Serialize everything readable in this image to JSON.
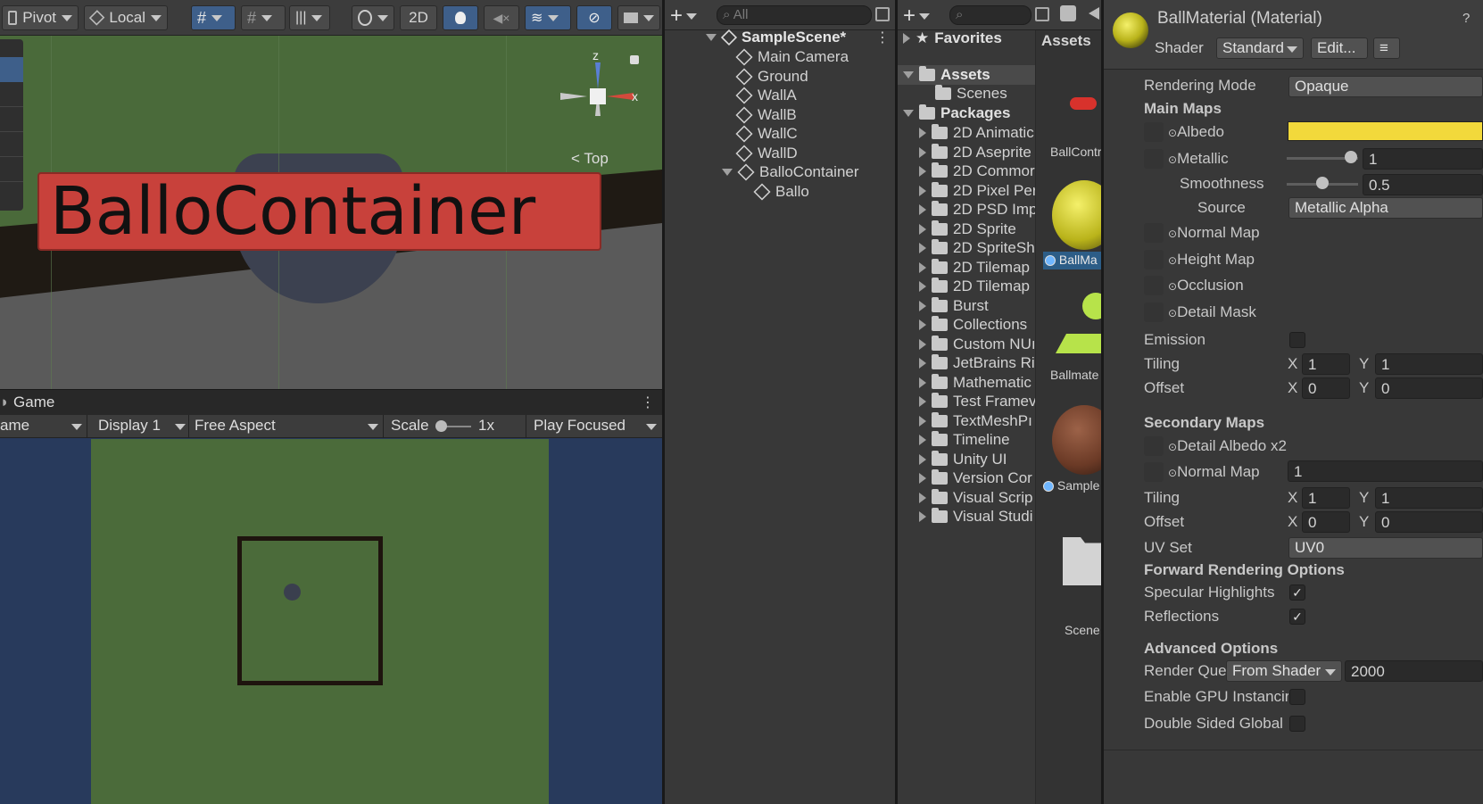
{
  "scene_toolbar": {
    "pivot_label": "Pivot",
    "local_label": "Local",
    "mode_2d_label": "2D"
  },
  "scene_view": {
    "gizmo_z": "z",
    "gizmo_x": "x",
    "gizmo_view_label": "Top",
    "selection_label": "BalloContainer"
  },
  "game_view": {
    "tab_label": "Game",
    "game_dropdown": "ame",
    "display_label": "Display 1",
    "aspect_label": "Free Aspect",
    "scale_label": "Scale",
    "scale_value": "1x",
    "play_focused_label": "Play Focused"
  },
  "hierarchy": {
    "search_placeholder": "All",
    "scene_name": "SampleScene*",
    "items": [
      {
        "label": "Main Camera"
      },
      {
        "label": "Ground"
      },
      {
        "label": "WallA"
      },
      {
        "label": "WallB"
      },
      {
        "label": "WallC"
      },
      {
        "label": "WallD"
      },
      {
        "label": "BalloContainer"
      },
      {
        "label": "Ballo"
      }
    ]
  },
  "project": {
    "favorites_label": "Favorites",
    "assets_label": "Assets",
    "scenes_label": "Scenes",
    "packages_label": "Packages",
    "packages": [
      "2D Animatic",
      "2D Aseprite",
      "2D Commor",
      "2D Pixel Per",
      "2D PSD Imp",
      "2D Sprite",
      "2D SpriteSh",
      "2D Tilemap",
      "2D Tilemap",
      "Burst",
      "Collections",
      "Custom NUı",
      "JetBrains Ri",
      "Mathematic",
      "Test Framev",
      "TextMeshPı",
      "Timeline",
      "Unity UI",
      "Version Cor",
      "Visual Scrip",
      "Visual Studi"
    ],
    "grid_header": "Assets",
    "grid_items": [
      {
        "label": "BallContr"
      },
      {
        "label": "BallMa"
      },
      {
        "label": "Ballmate"
      },
      {
        "label": "Sample"
      },
      {
        "label": "Scene"
      }
    ]
  },
  "inspector": {
    "title": "BallMaterial (Material)",
    "shader_label": "Shader",
    "shader_value": "Standard",
    "edit_label": "Edit...",
    "rendering_mode_label": "Rendering Mode",
    "rendering_mode_value": "Opaque",
    "main_maps_label": "Main Maps",
    "albedo_label": "Albedo",
    "albedo_color": "#f2d93b",
    "metallic_label": "Metallic",
    "metallic_value": "1",
    "smoothness_label": "Smoothness",
    "smoothness_value": "0.5",
    "source_label": "Source",
    "source_value": "Metallic Alpha",
    "normal_map_label": "Normal Map",
    "height_map_label": "Height Map",
    "occlusion_label": "Occlusion",
    "detail_mask_label": "Detail Mask",
    "emission_label": "Emission",
    "tiling_label": "Tiling",
    "offset_label": "Offset",
    "x_label": "X",
    "y_label": "Y",
    "main_tiling_x": "1",
    "main_tiling_y": "1",
    "main_offset_x": "0",
    "main_offset_y": "0",
    "secondary_maps_label": "Secondary Maps",
    "detail_albedo_label": "Detail Albedo x2",
    "secondary_normal_label": "Normal Map",
    "secondary_normal_value": "1",
    "sec_tiling_x": "1",
    "sec_tiling_y": "1",
    "sec_offset_x": "0",
    "sec_offset_y": "0",
    "uv_set_label": "UV Set",
    "uv_set_value": "UV0",
    "forward_rendering_label": "Forward Rendering Options",
    "specular_label": "Specular Highlights",
    "reflections_label": "Reflections",
    "advanced_label": "Advanced Options",
    "render_queue_label": "Render Que",
    "render_queue_mode": "From Shader",
    "render_queue_value": "2000",
    "gpu_instancing_label": "Enable GPU Instancir",
    "double_sided_label": "Double Sided Global I",
    "check_mark": "✓"
  }
}
